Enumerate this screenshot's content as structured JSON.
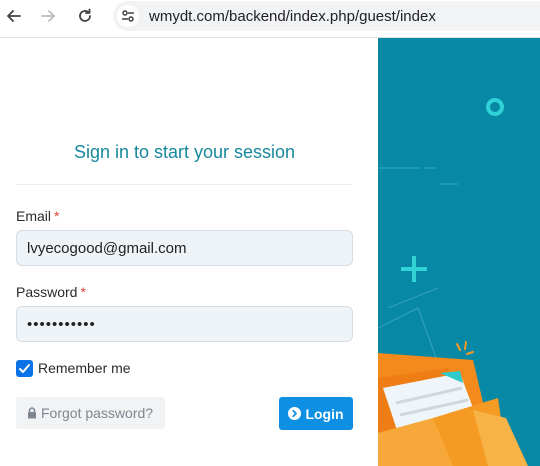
{
  "browser": {
    "url": "wmydt.com/backend/index.php/guest/index"
  },
  "login": {
    "title": "Sign in to start your session",
    "email_label": "Email",
    "email_value": "lvyecogood@gmail.com",
    "password_label": "Password",
    "password_value": "•••••••••••",
    "required_mark": "*",
    "remember_label": "Remember me",
    "remember_checked": true,
    "forgot_label": "Forgot password?",
    "login_label": "Login"
  },
  "colors": {
    "title": "#17889b",
    "primary_button": "#0d8fe4",
    "illustration_bg": "#0788a5",
    "envelope_orange": "#f48a1c"
  }
}
